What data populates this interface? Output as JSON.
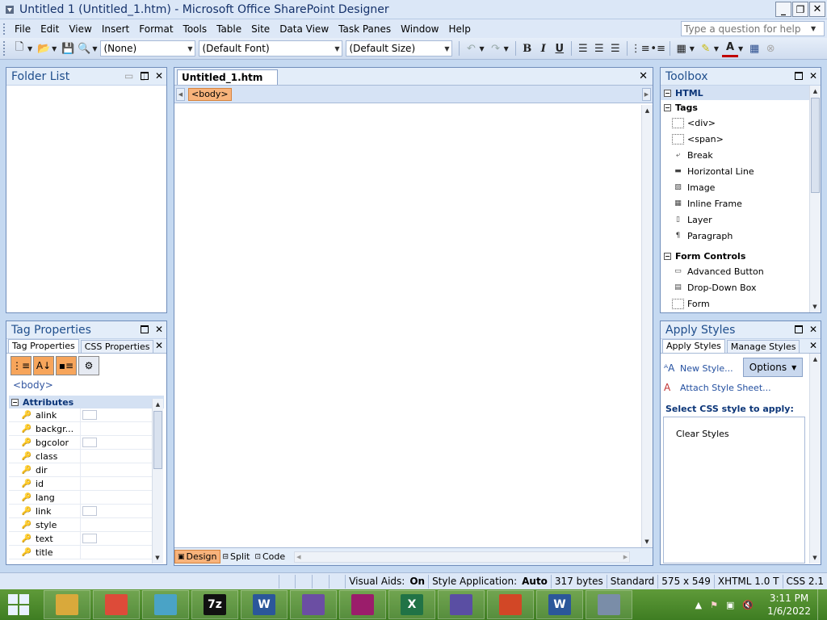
{
  "window": {
    "title": "Untitled 1 (Untitled_1.htm) - Microsoft Office SharePoint Designer",
    "controls": {
      "minimize": "_",
      "restore": "❐",
      "close": "✕"
    }
  },
  "menu": {
    "items": [
      "File",
      "Edit",
      "View",
      "Insert",
      "Format",
      "Tools",
      "Table",
      "Site",
      "Data View",
      "Task Panes",
      "Window",
      "Help"
    ],
    "help_placeholder": "Type a question for help"
  },
  "toolbar": {
    "style_value": "(None)",
    "font_value": "(Default Font)",
    "size_value": "(Default Size)",
    "bold": "B",
    "italic": "I",
    "underline": "U"
  },
  "folder_list": {
    "title": "Folder List"
  },
  "tag_properties": {
    "title": "Tag Properties",
    "tabs": [
      "Tag Properties",
      "CSS Properties"
    ],
    "current_tag": "<body>",
    "attributes_header": "Attributes",
    "attributes": [
      "alink",
      "backgr...",
      "bgcolor",
      "class",
      "dir",
      "id",
      "lang",
      "link",
      "style",
      "text",
      "title"
    ],
    "color_swatch_attrs": [
      "alink",
      "bgcolor",
      "link",
      "text"
    ]
  },
  "editor": {
    "tab_label": "Untitled_1.htm",
    "tag_chip": "<body>",
    "views": [
      "Design",
      "Split",
      "Code"
    ]
  },
  "toolbox": {
    "title": "Toolbox",
    "html_section": "HTML",
    "tags_section": "Tags",
    "tags": [
      "<div>",
      "<span>",
      "Break",
      "Horizontal Line",
      "Image",
      "Inline Frame",
      "Layer",
      "Paragraph"
    ],
    "form_section": "Form Controls",
    "form_controls": [
      "Advanced Button",
      "Drop-Down Box",
      "Form"
    ]
  },
  "apply_styles": {
    "title": "Apply Styles",
    "tabs": [
      "Apply Styles",
      "Manage Styles"
    ],
    "new_style": "New Style...",
    "attach_sheet": "Attach Style Sheet...",
    "options": "Options",
    "select_label": "Select CSS style to apply:",
    "clear_styles": "Clear Styles"
  },
  "statusbar": {
    "visual_aids_label": "Visual Aids:",
    "visual_aids_value": "On",
    "style_app_label": "Style Application:",
    "style_app_value": "Auto",
    "size": "317 bytes",
    "mode": "Standard",
    "dimensions": "575 x 549",
    "doctype": "XHTML 1.0 T",
    "css": "CSS 2.1"
  },
  "taskbar": {
    "apps": [
      {
        "name": "file-explorer",
        "label": "",
        "color": "#d9a93b"
      },
      {
        "name": "chrome",
        "label": "",
        "color": "#dd4b39"
      },
      {
        "name": "control-panel",
        "label": "",
        "color": "#4aa3c6"
      },
      {
        "name": "7zip",
        "label": "7z",
        "color": "#111111"
      },
      {
        "name": "word",
        "label": "W",
        "color": "#2b579a"
      },
      {
        "name": "infopath",
        "label": "",
        "color": "#6b4ea3"
      },
      {
        "name": "onenote-tool",
        "label": "",
        "color": "#9b1d6b"
      },
      {
        "name": "excel",
        "label": "X",
        "color": "#217346"
      },
      {
        "name": "visio",
        "label": "",
        "color": "#5a4ea3"
      },
      {
        "name": "powerpoint",
        "label": "",
        "color": "#d24726"
      },
      {
        "name": "word-doc",
        "label": "W",
        "color": "#2b579a"
      },
      {
        "name": "outlook",
        "label": "",
        "color": "#7a8da8"
      }
    ],
    "time": "3:11 PM",
    "date": "1/6/2022"
  }
}
